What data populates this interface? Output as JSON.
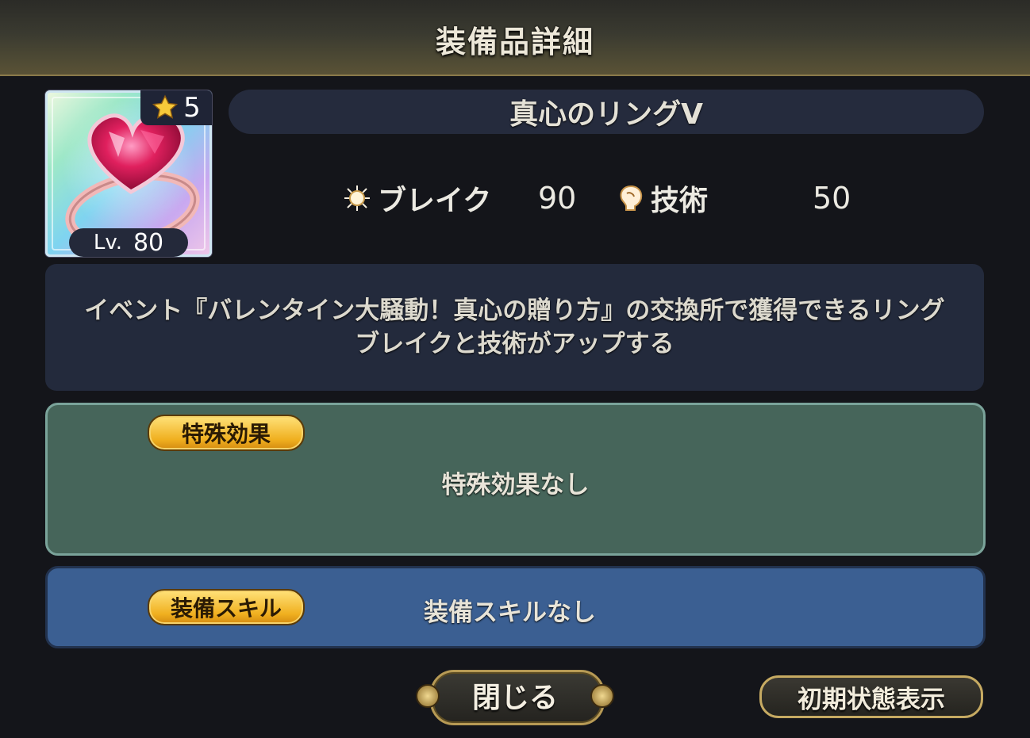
{
  "header": {
    "title": "装備品詳細"
  },
  "item": {
    "rarity": "5",
    "level_prefix": "Lv.",
    "level": "80",
    "name": "真心のリングⅤ",
    "icon": "heart-gem-ring-icon"
  },
  "stats": [
    {
      "icon": "break-burst-icon",
      "label": "ブレイク",
      "value": "90"
    },
    {
      "icon": "technique-head-icon",
      "label": "技術",
      "value": "50"
    }
  ],
  "description": {
    "line1": "イベント『バレンタイン大騒動！真心の贈り方』の交換所で獲得できるリング",
    "line2": "ブレイクと技術がアップする"
  },
  "special_effect": {
    "tag": "特殊効果",
    "text": "特殊効果なし"
  },
  "equip_skill": {
    "tag": "装備スキル",
    "text": "装備スキルなし"
  },
  "buttons": {
    "close": "閉じる",
    "reset": "初期状態表示"
  },
  "colors": {
    "effect_panel": "#46655a",
    "skill_panel": "#3b5f92",
    "tag_gold": "#f0b020"
  }
}
